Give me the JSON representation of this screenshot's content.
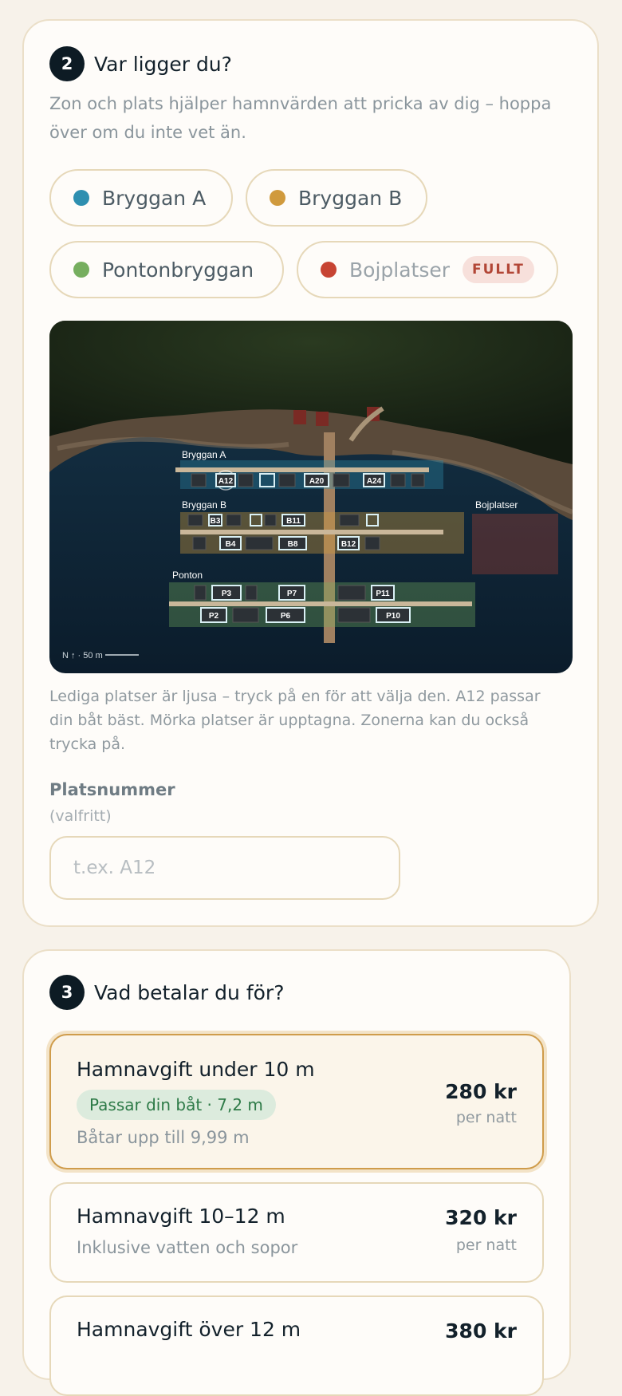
{
  "step2": {
    "number": "2",
    "title": "Var ligger du?",
    "intro": "Zon och plats hjälper hamnvärden att pricka av dig – hoppa över om du inte vet än.",
    "zones": [
      {
        "label": "Bryggan A",
        "color": "#2e8fb0"
      },
      {
        "label": "Bryggan B",
        "color": "#d09a3d"
      },
      {
        "label": "Pontonbryggan",
        "color": "#76ae5f"
      },
      {
        "label": "Bojplatser",
        "color": "#c74433",
        "badge": "FULLT"
      }
    ],
    "map": {
      "zone_labels": {
        "a": "Bryggan A",
        "b": "Bryggan B",
        "ponton": "Ponton",
        "boj": "Bojplatser"
      },
      "berths": {
        "a12": "A12",
        "a20": "A20",
        "a24": "A24",
        "b3": "B3",
        "b11": "B11",
        "b4": "B4",
        "b8": "B8",
        "b12": "B12",
        "p3": "P3",
        "p7": "P7",
        "p11": "P11",
        "p2": "P2",
        "p6": "P6",
        "p10": "P10"
      },
      "scale": "N ↑ · 50 m"
    },
    "caption": "Lediga platser är ljusa – tryck på en för att välja den. A12 passar din båt bäst. Mörka platser är upptagna. Zonerna kan du också trycka på.",
    "field_label": "Platsnummer",
    "field_hint": "(valfritt)",
    "field_placeholder": "t.ex. A12"
  },
  "step3": {
    "number": "3",
    "title": "Vad betalar du för?",
    "options": [
      {
        "title": "Hamnavgift under 10 m",
        "fit": "Passar din båt · 7,2 m",
        "sub": "Båtar upp till 9,99 m",
        "price": "280 kr",
        "unit": "per natt"
      },
      {
        "title": "Hamnavgift 10–12 m",
        "sub": "Inklusive vatten och sopor",
        "price": "320 kr",
        "unit": "per natt"
      },
      {
        "title": "Hamnavgift över 12 m",
        "price": "380 kr"
      }
    ]
  }
}
